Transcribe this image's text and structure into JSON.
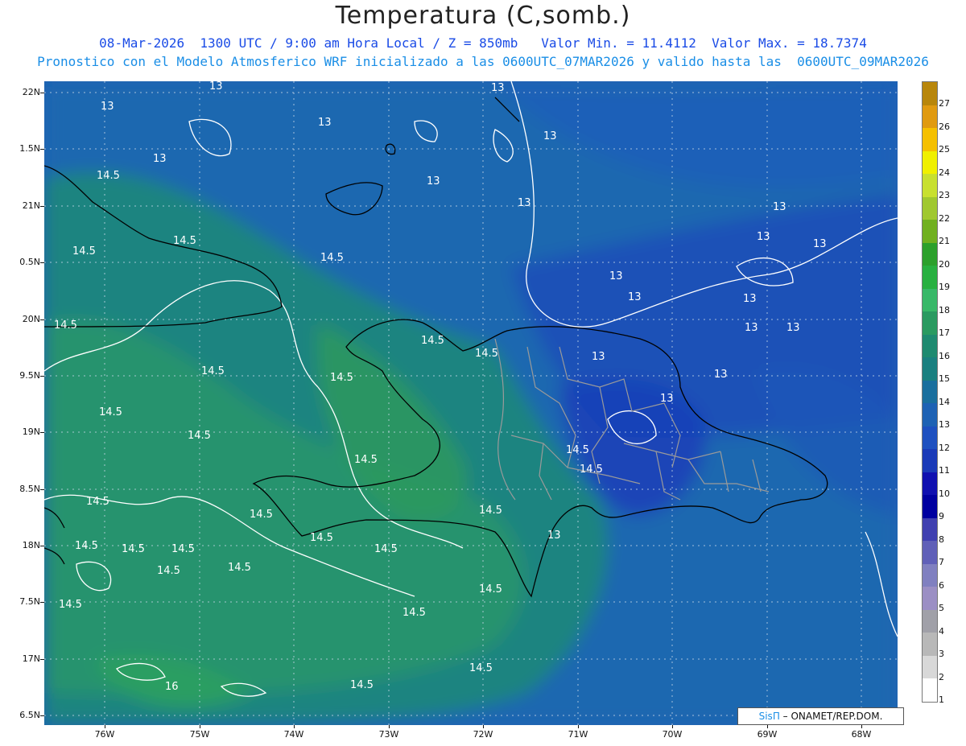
{
  "title": "Temperatura (C,somb.)",
  "subtitle_line1": "08-Mar-2026  1300 UTC / 9:00 am Hora Local / Z = 850mb   Valor Min. = 11.4112  Valor Max. = 18.7374",
  "subtitle_line2": "Pronostico con el Modelo Atmosferico WRF inicializado a las 0600UTC_07MAR2026 y valido hasta las  0600UTC_09MAR2026",
  "lat_labels": [
    "22N",
    "1.5N",
    "21N",
    "0.5N",
    "20N",
    "9.5N",
    "19N",
    "8.5N",
    "18N",
    "7.5N",
    "17N",
    "6.5N"
  ],
  "lon_labels": [
    "76W",
    "75W",
    "74W",
    "73W",
    "72W",
    "71W",
    "70W",
    "69W",
    "68W"
  ],
  "colorbar": {
    "labels": [
      "27",
      "26",
      "25",
      "24",
      "23",
      "22",
      "21",
      "20",
      "19",
      "18",
      "17",
      "16",
      "15",
      "14",
      "13",
      "12",
      "11",
      "10",
      "9",
      "8",
      "7",
      "6",
      "5",
      "4",
      "3",
      "2",
      "1"
    ],
    "colors": [
      "#b8860b",
      "#e09a10",
      "#f5c000",
      "#f0f000",
      "#c8e030",
      "#a0c830",
      "#70b020",
      "#2ca02c",
      "#28b040",
      "#38b868",
      "#2a9a60",
      "#1e8a70",
      "#1a8080",
      "#1a6f9e",
      "#1e62b4",
      "#1e50c0",
      "#1a3ab8",
      "#1010b0",
      "#0000a0",
      "#4040b0",
      "#6060b8",
      "#8080c0",
      "#9b8fc4",
      "#a0a0a8",
      "#b8b8b8",
      "#d8d8d8",
      "#ffffff"
    ]
  },
  "contour_labels": [
    "13",
    "14.5",
    "16"
  ],
  "credit": {
    "brand": "SisΠ",
    "text": "– ONAMET/REP.DOM."
  },
  "colors": {
    "deep_blue": "#1e62b4",
    "teal": "#1f8a6e",
    "green": "#2d9a5c",
    "coast": "#000000",
    "provinces": "#9a9a9a",
    "contours": "#ffffff"
  }
}
